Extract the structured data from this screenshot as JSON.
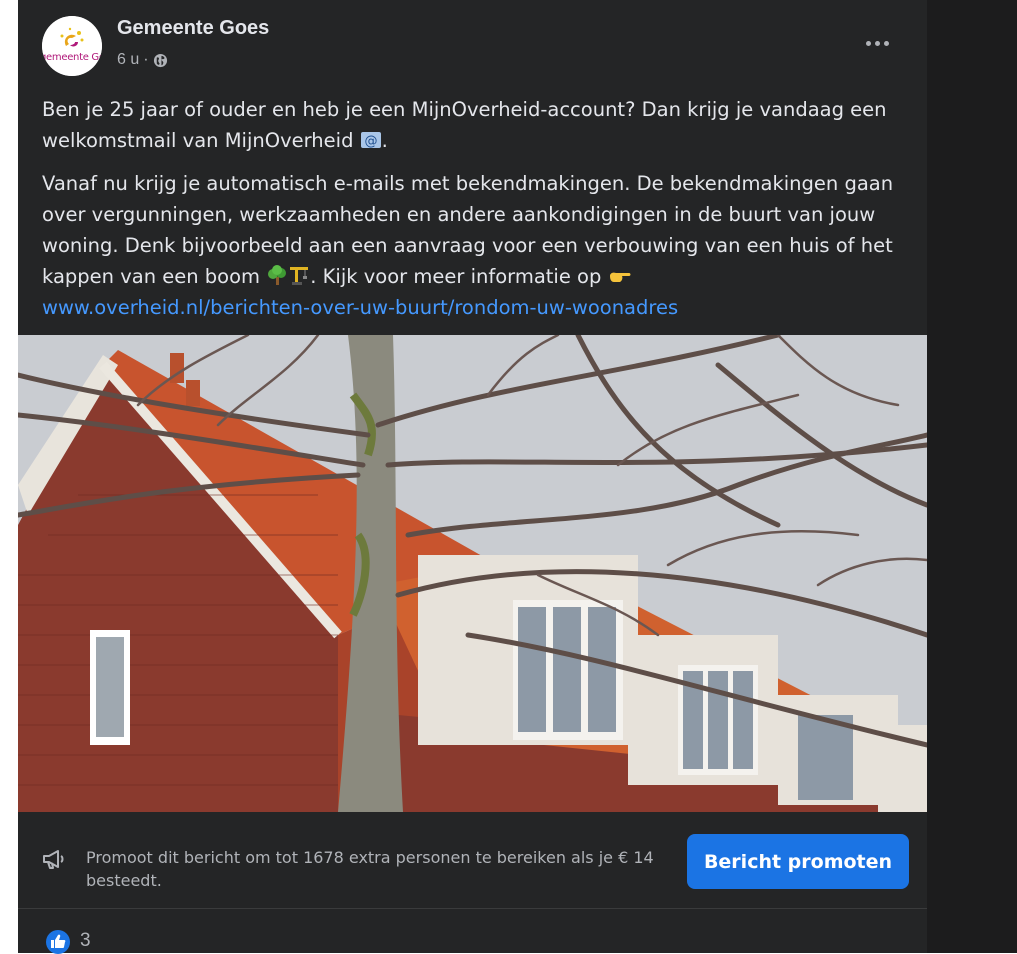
{
  "post": {
    "page_name": "Gemeente Goes",
    "avatar_text": "gemeente Goes",
    "time": "6 u",
    "separator": "·",
    "visibility_icon": "globe-icon",
    "more_icon": "more-dots-icon",
    "paragraph1_text": "Ben je 25 jaar of ouder en heb je een MijnOverheid-account? Dan krijg je vandaag een welkomstmail van MijnOverheid",
    "paragraph1_emoji": "email-icon",
    "paragraph1_end": ".",
    "paragraph2_text": "Vanaf nu krijg je automatisch e-mails met bekendmakingen. De bekendmakingen gaan over vergunningen, werkzaamheden en andere aankondigingen in de buurt van jouw woning. Denk bijvoorbeeld aan een aanvraag voor een verbouwing van een huis of het kappen van een boom",
    "paragraph2_emojis": [
      "tree-icon",
      "construction-crane-icon"
    ],
    "paragraph2_after": ". Kijk voor meer informatie op",
    "paragraph2_pointer": "pointing-hand-icon",
    "link": "www.overheid.nl/berichten-over-uw-buurt/rondom-uw-woonadres",
    "photo": "photo of brick houses with orange roof tiles behind bare tree branches"
  },
  "promotion": {
    "icon": "megaphone-icon",
    "text": "Promoot dit bericht om tot 1678 extra personen te bereiken als je € 14 besteedt.",
    "button_label": "Bericht promoten"
  },
  "reactions": {
    "icon": "like-icon",
    "count": "3"
  },
  "colors": {
    "card_bg": "#242526",
    "text_primary": "#e4e6eb",
    "text_secondary": "#b0b3b8",
    "link": "#4599ff",
    "button": "#1b74e4"
  }
}
